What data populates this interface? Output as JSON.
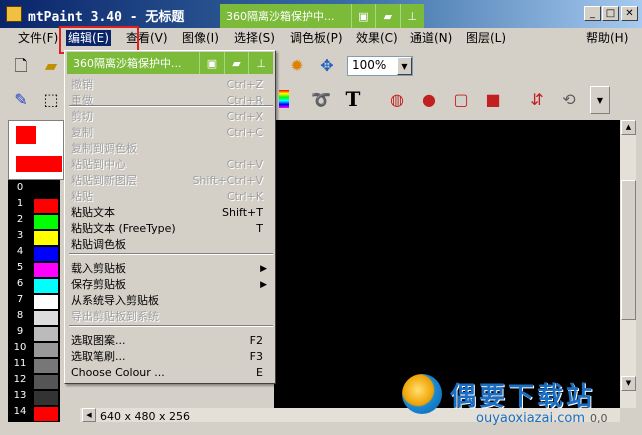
{
  "window": {
    "title": "mtPaint 3.40 - 无标题",
    "minimize": "_",
    "maximize": "□",
    "close": "✕"
  },
  "banner": {
    "text": "360隔离沙箱保护中...",
    "icons": [
      "window-icon",
      "folder-icon",
      "pin-icon"
    ]
  },
  "menubar": {
    "items": [
      "文件(F)",
      "编辑(E)",
      "查看(V)",
      "图像(I)",
      "选择(S)",
      "调色板(P)",
      "效果(C)",
      "通道(N)",
      "图层(L)",
      "帮助(H)"
    ],
    "active": "编辑(E)"
  },
  "toolbar": {
    "zoom": "100%"
  },
  "palette": {
    "indices": [
      "0",
      "1",
      "2",
      "3",
      "4",
      "5",
      "6",
      "7",
      "8",
      "9",
      "10",
      "11",
      "12",
      "13",
      "14"
    ],
    "colors": [
      "#000000",
      "#ff0000",
      "#00ff00",
      "#ffff00",
      "#0000ff",
      "#ff00ff",
      "#00ffff",
      "#ffffff",
      "#dddddd",
      "#bbbbbb",
      "#999999",
      "#777777",
      "#555555",
      "#333333",
      "#ff0000"
    ]
  },
  "status": {
    "image_info": "640 x 480 x 256",
    "coords": "0,0"
  },
  "edit_menu": {
    "items": [
      {
        "label": "撤销",
        "shortcut": "Ctrl+Z",
        "enabled": false
      },
      {
        "label": "重做",
        "shortcut": "Ctrl+R",
        "enabled": false
      },
      {
        "label": "剪切",
        "shortcut": "Ctrl+X",
        "enabled": false
      },
      {
        "label": "复制",
        "shortcut": "Ctrl+C",
        "enabled": false
      },
      {
        "label": "复制到调色板",
        "shortcut": "",
        "enabled": false
      },
      {
        "label": "粘贴到中心",
        "shortcut": "Ctrl+V",
        "enabled": false
      },
      {
        "label": "粘贴到新图层",
        "shortcut": "Shift+Ctrl+V",
        "enabled": false
      },
      {
        "label": "粘贴",
        "shortcut": "Ctrl+K",
        "enabled": false
      },
      {
        "label": "粘贴文本",
        "shortcut": "Shift+T",
        "enabled": true
      },
      {
        "label": "粘贴文本 (FreeType)",
        "shortcut": "T",
        "enabled": true
      },
      {
        "label": "粘贴调色板",
        "shortcut": "",
        "enabled": true
      },
      {
        "label": "载入剪贴板",
        "shortcut": "",
        "enabled": true,
        "submenu": true
      },
      {
        "label": "保存剪贴板",
        "shortcut": "",
        "enabled": true,
        "submenu": true
      },
      {
        "label": "从系统导入剪贴板",
        "shortcut": "",
        "enabled": true
      },
      {
        "label": "导出剪贴板到系统",
        "shortcut": "",
        "enabled": false
      },
      {
        "label": "选取图案...",
        "shortcut": "F2",
        "enabled": true
      },
      {
        "label": "选取笔刷...",
        "shortcut": "F3",
        "enabled": true
      },
      {
        "label": "Choose Colour ...",
        "shortcut": "E",
        "enabled": true
      }
    ]
  },
  "watermark": {
    "title": "偶要下载站",
    "url": "ouyaoxiazai.com"
  }
}
